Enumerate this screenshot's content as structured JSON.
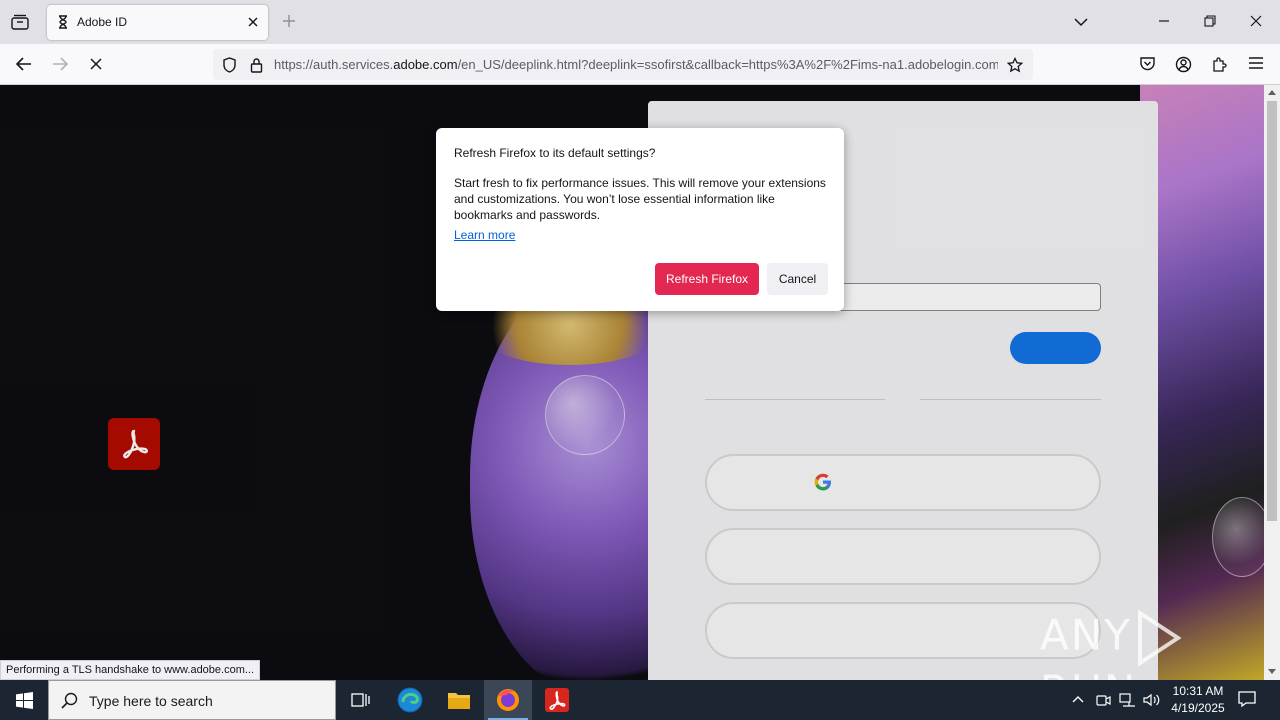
{
  "browser": {
    "tab": {
      "title": "Adobe ID"
    },
    "url": {
      "prefix": "https://auth.services.",
      "domain": "adobe.com",
      "rest": "/en_US/deeplink.html?deeplink=ssofirst&callback=https%3A%2F%2Fims-na1.adobelogin.com"
    },
    "status": "Performing a TLS handshake to www.adobe.com..."
  },
  "dialog": {
    "title": "Refresh Firefox to its default settings?",
    "description": "Start fresh to fix performance issues. This will remove your extensions and customizations. You won’t lose essential information like bookmarks and passwords.",
    "learn_more": "Learn more",
    "primary_button": "Refresh Firefox",
    "secondary_button": "Cancel",
    "colors": {
      "primary": "#e22850",
      "link": "#0061e0"
    }
  },
  "page": {
    "brand_color": "#b30b00",
    "continue_color": "#1473e6",
    "icons": [
      "acrobat-logo",
      "google-icon"
    ]
  },
  "watermark": {
    "left": "ANY",
    "right": "RUN"
  },
  "taskbar": {
    "search_placeholder": "Type here to search",
    "apps": [
      "task-view",
      "edge",
      "file-explorer",
      "firefox",
      "acrobat"
    ],
    "time": "10:31 AM",
    "date": "4/19/2025"
  }
}
